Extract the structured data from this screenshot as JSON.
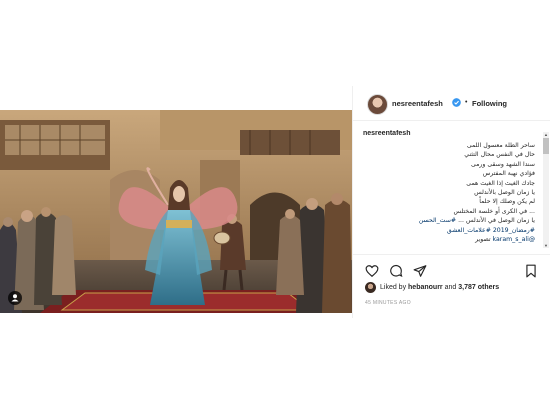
{
  "post": {
    "username": "nesreentafesh",
    "separator": "•",
    "follow_status": "Following",
    "caption_username": "nesreentafesh",
    "caption_lines": [
      "ساحر الطلة معسول اللمى",
      "حال في النفس محال التثني",
      "سندا الشهد وسقى ورمى",
      "فؤادي نهبة المفترس",
      "جادك الغيث إذا الغيث همى",
      "يا زمان الوصل بالأندلس",
      "لم يكن وصلك إلا حلماً",
      "... في الكرى أو خلسة المختلس"
    ],
    "caption_hashtag_line_prefix": "يا زمان الوصل في الأندلس ... ",
    "caption_hashtag_line_tag": "#ست_الحسن",
    "caption_tags_line": "#رمضان_2019 #علامات_العشق",
    "photo_credit_label": "تصوير",
    "photo_credit_user": "@karam_s_ali",
    "liked_by_prefix": "Liked by",
    "liked_by_user": "hebanourr",
    "liked_by_and": "and",
    "likes_count": "3,787 others",
    "timestamp": "45 MINUTES AGO"
  },
  "icons": {
    "verified": "verified-badge-icon",
    "heart": "heart-icon",
    "comment": "comment-icon",
    "share": "share-icon",
    "save": "bookmark-icon",
    "tag": "user-tag-icon"
  },
  "colors": {
    "verified": "#3897f0",
    "link": "#003569",
    "muted": "#999999"
  }
}
